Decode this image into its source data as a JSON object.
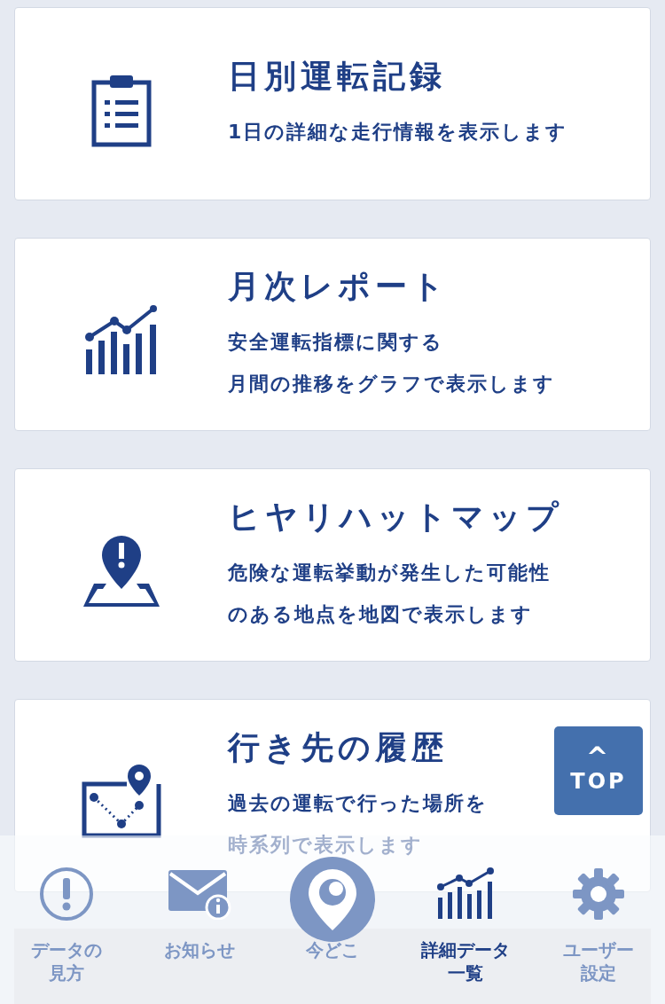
{
  "cards": [
    {
      "title": "日別運転記録",
      "lines": [
        "1日の詳細な走行情報を表示します"
      ]
    },
    {
      "title": "月次レポート",
      "lines": [
        "安全運転指標に関する",
        "月間の推移をグラフで表示します"
      ]
    },
    {
      "title": "ヒヤリハットマップ",
      "lines": [
        "危険な運転挙動が発生した可能性",
        "のある地点を地図で表示します"
      ]
    },
    {
      "title": "行き先の履歴",
      "lines": [
        "過去の運転で行った場所を",
        "時系列で表示します"
      ]
    }
  ],
  "top_button": {
    "arrow": "^",
    "label": "TOP"
  },
  "nav": [
    {
      "label": [
        "データの",
        "見方"
      ],
      "kind": "plain",
      "selected": false
    },
    {
      "label": [
        "お知らせ"
      ],
      "kind": "plain",
      "selected": false
    },
    {
      "label": [
        "今どこ"
      ],
      "kind": "circle",
      "selected": false
    },
    {
      "label": [
        "詳細データ",
        "一覧"
      ],
      "kind": "plain",
      "selected": true
    },
    {
      "label": [
        "ユーザー",
        "設定"
      ],
      "kind": "plain",
      "selected": false
    }
  ]
}
